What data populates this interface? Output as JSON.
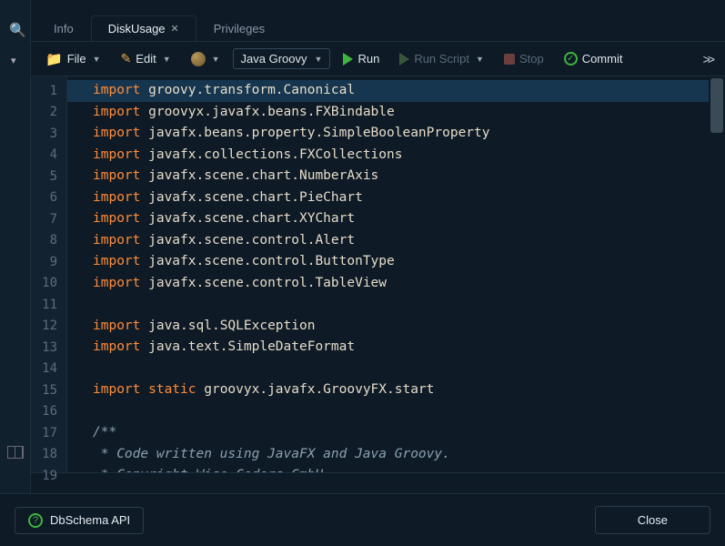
{
  "tabs": [
    {
      "label": "Info",
      "active": false,
      "closable": false
    },
    {
      "label": "DiskUsage",
      "active": true,
      "closable": true
    },
    {
      "label": "Privileges",
      "active": false,
      "closable": false
    }
  ],
  "toolbar": {
    "file_label": "File",
    "edit_label": "Edit",
    "lang_label": "Java Groovy",
    "run_label": "Run",
    "run_script_label": "Run Script",
    "stop_label": "Stop",
    "commit_label": "Commit"
  },
  "code": {
    "lines": [
      {
        "n": 1,
        "t": "kw-plain",
        "kw": "import",
        "rest": " groovy.transform.Canonical",
        "current": true
      },
      {
        "n": 2,
        "t": "kw-plain",
        "kw": "import",
        "rest": " groovyx.javafx.beans.FXBindable"
      },
      {
        "n": 3,
        "t": "kw-plain",
        "kw": "import",
        "rest": " javafx.beans.property.SimpleBooleanProperty"
      },
      {
        "n": 4,
        "t": "kw-plain",
        "kw": "import",
        "rest": " javafx.collections.FXCollections"
      },
      {
        "n": 5,
        "t": "kw-plain",
        "kw": "import",
        "rest": " javafx.scene.chart.NumberAxis"
      },
      {
        "n": 6,
        "t": "kw-plain",
        "kw": "import",
        "rest": " javafx.scene.chart.PieChart"
      },
      {
        "n": 7,
        "t": "kw-plain",
        "kw": "import",
        "rest": " javafx.scene.chart.XYChart"
      },
      {
        "n": 8,
        "t": "kw-plain",
        "kw": "import",
        "rest": " javafx.scene.control.Alert"
      },
      {
        "n": 9,
        "t": "kw-plain",
        "kw": "import",
        "rest": " javafx.scene.control.ButtonType"
      },
      {
        "n": 10,
        "t": "kw-plain",
        "kw": "import",
        "rest": " javafx.scene.control.TableView"
      },
      {
        "n": 11,
        "t": "blank"
      },
      {
        "n": 12,
        "t": "kw-plain",
        "kw": "import",
        "rest": " java.sql.SQLException"
      },
      {
        "n": 13,
        "t": "kw-plain",
        "kw": "import",
        "rest": " java.text.SimpleDateFormat"
      },
      {
        "n": 14,
        "t": "blank"
      },
      {
        "n": 15,
        "t": "kw-kw2-plain",
        "kw": "import",
        "kw2": " static",
        "rest": " groovyx.javafx.GroovyFX.start"
      },
      {
        "n": 16,
        "t": "blank"
      },
      {
        "n": 17,
        "t": "comment",
        "text": "/**"
      },
      {
        "n": 18,
        "t": "comment",
        "text": " * Code written using JavaFX and Java Groovy."
      },
      {
        "n": 19,
        "t": "comment",
        "text": " * Copyright Wise Coders GmbH."
      }
    ]
  },
  "bottom": {
    "api_label": "DbSchema API",
    "close_label": "Close"
  }
}
